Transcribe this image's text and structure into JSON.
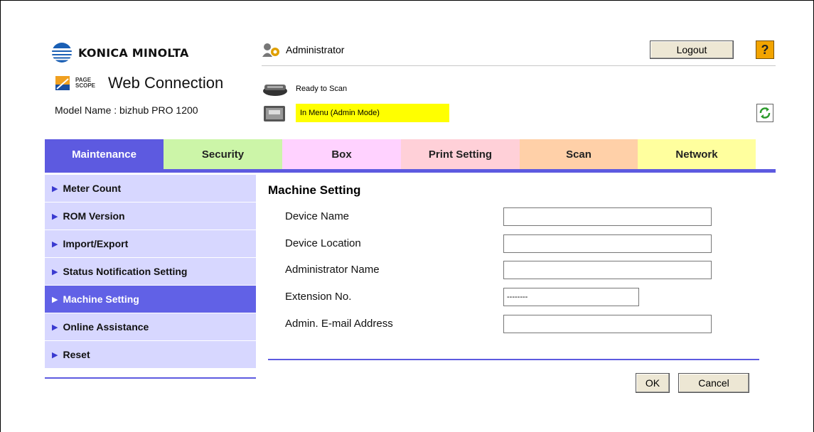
{
  "header": {
    "brand_name": "KONICA MINOLTA",
    "product_tag": "PAGE SCOPE",
    "product_name": "Web Connection",
    "model_label": "Model Name : bizhub PRO 1200",
    "user": "Administrator",
    "logout_label": "Logout",
    "help_label": "?"
  },
  "status": {
    "scanner": "Ready to Scan",
    "printer": "In Menu (Admin Mode)"
  },
  "tabs": [
    {
      "label": "Maintenance",
      "color": "#5d5ae0",
      "text_color": "#ffffff",
      "active": true
    },
    {
      "label": "Security",
      "color": "#ccf5a8",
      "text_color": "#222222"
    },
    {
      "label": "Box",
      "color": "#ffd2ff",
      "text_color": "#222222"
    },
    {
      "label": "Print Setting",
      "color": "#ffd0d8",
      "text_color": "#222222"
    },
    {
      "label": "Scan",
      "color": "#ffd0a8",
      "text_color": "#222222"
    },
    {
      "label": "Network",
      "color": "#ffff9e",
      "text_color": "#222222"
    }
  ],
  "sidebar": {
    "items": [
      {
        "label": "Meter Count"
      },
      {
        "label": "ROM Version"
      },
      {
        "label": "Import/Export"
      },
      {
        "label": "Status Notification Setting"
      },
      {
        "label": "Machine Setting",
        "active": true
      },
      {
        "label": "Online Assistance"
      },
      {
        "label": "Reset"
      }
    ]
  },
  "main": {
    "title": "Machine Setting",
    "fields": [
      {
        "label": "Device Name",
        "value": ""
      },
      {
        "label": "Device Location",
        "value": ""
      },
      {
        "label": "Administrator Name",
        "value": ""
      },
      {
        "label": "Extension No.",
        "value": "--------"
      },
      {
        "label": "Admin. E-mail Address",
        "value": ""
      }
    ],
    "ok_label": "OK",
    "cancel_label": "Cancel"
  },
  "colors": {
    "accent": "#5d5ae0",
    "sidebar_bg": "#d7d7ff",
    "sidebar_active": "#6161e6",
    "status_highlight": "#ffff00"
  }
}
